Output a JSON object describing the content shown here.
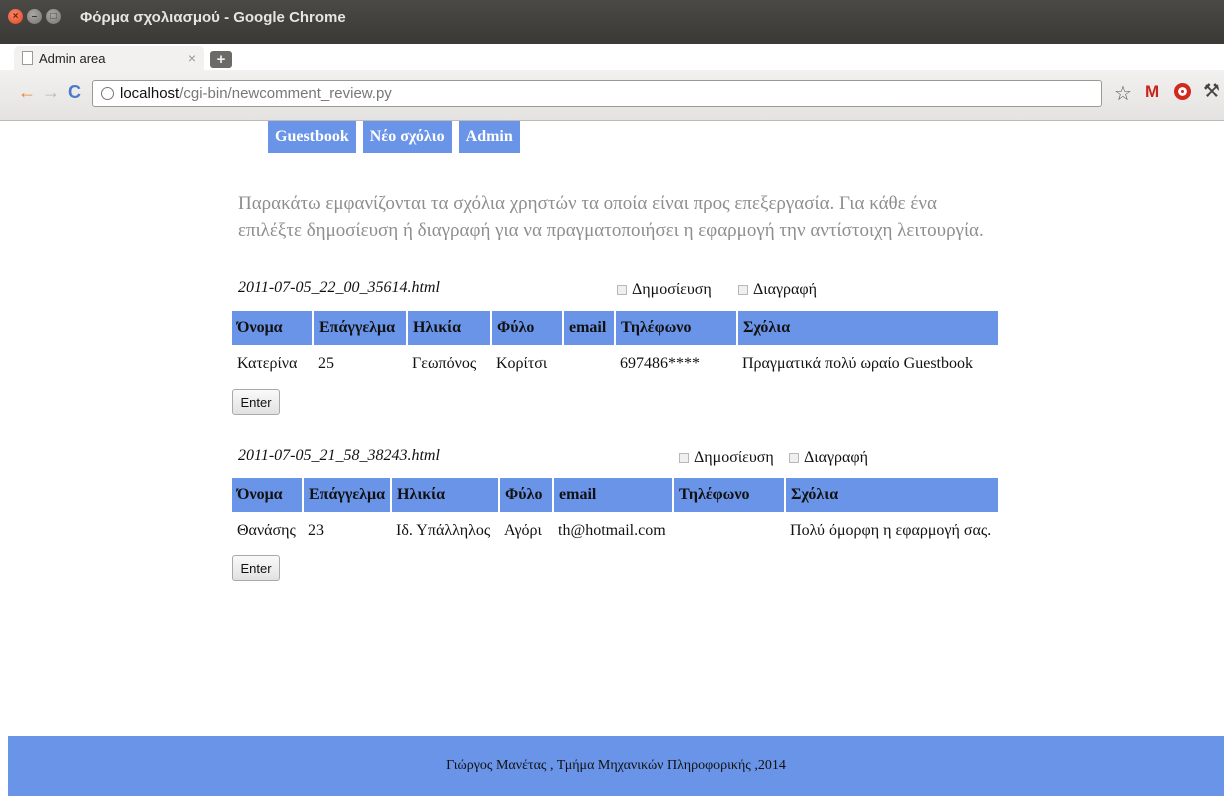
{
  "window": {
    "title": "Φόρμα σχολιασμού - Google Chrome",
    "tab_label": "Admin area"
  },
  "address_bar": {
    "host": "localhost",
    "path": "/cgi-bin/newcomment_review.py"
  },
  "nav": {
    "links": [
      "Guestbook",
      "Νέο σχόλιο",
      "Admin"
    ]
  },
  "intro": "Παρακάτω εμφανίζονται τα σχόλια χρηστών τα οποία είναι προς επεξεργασία. Για κάθε ένα επιλέξτε δημοσίευση ή διαγραφή για να πραγματοποιήσει η εφαρμογή την αντίστοιχη λειτουργία.",
  "comments": [
    {
      "filename": "2011-07-05_22_00_35614.html",
      "publish_label": "Δημοσίευση",
      "delete_label": "Διαγραφή",
      "headers": [
        "Όνομα",
        "Επάγγελμα",
        "Ηλικία",
        "Φύλο",
        "email",
        "Τηλέφωνο",
        "Σχόλια"
      ],
      "row": [
        "Κατερίνα",
        "25",
        "Γεωπόνος",
        "Κορίτσι",
        "",
        "697486****",
        "Πραγματικά πολύ ωραίο Guestbook"
      ],
      "enter_label": "Enter"
    },
    {
      "filename": "2011-07-05_21_58_38243.html",
      "publish_label": "Δημοσίευση",
      "delete_label": "Διαγραφή",
      "headers": [
        "Όνομα",
        "Επάγγελμα",
        "Ηλικία",
        "Φύλο",
        "email",
        "Τηλέφωνο",
        "Σχόλια"
      ],
      "row": [
        "Θανάσης",
        "23",
        "Ιδ. Υπάλληλος",
        "Αγόρι",
        "th@hotmail.com",
        "",
        "Πολύ όμορφη η εφαρμογή σας."
      ],
      "enter_label": "Enter"
    }
  ],
  "footer": "Γιώργος Μανέτας , Τμήμα Μηχανικών Πληροφορικής ,2014",
  "colors": {
    "accent": "#6a94e8",
    "intro_text": "#8e8e8e"
  }
}
